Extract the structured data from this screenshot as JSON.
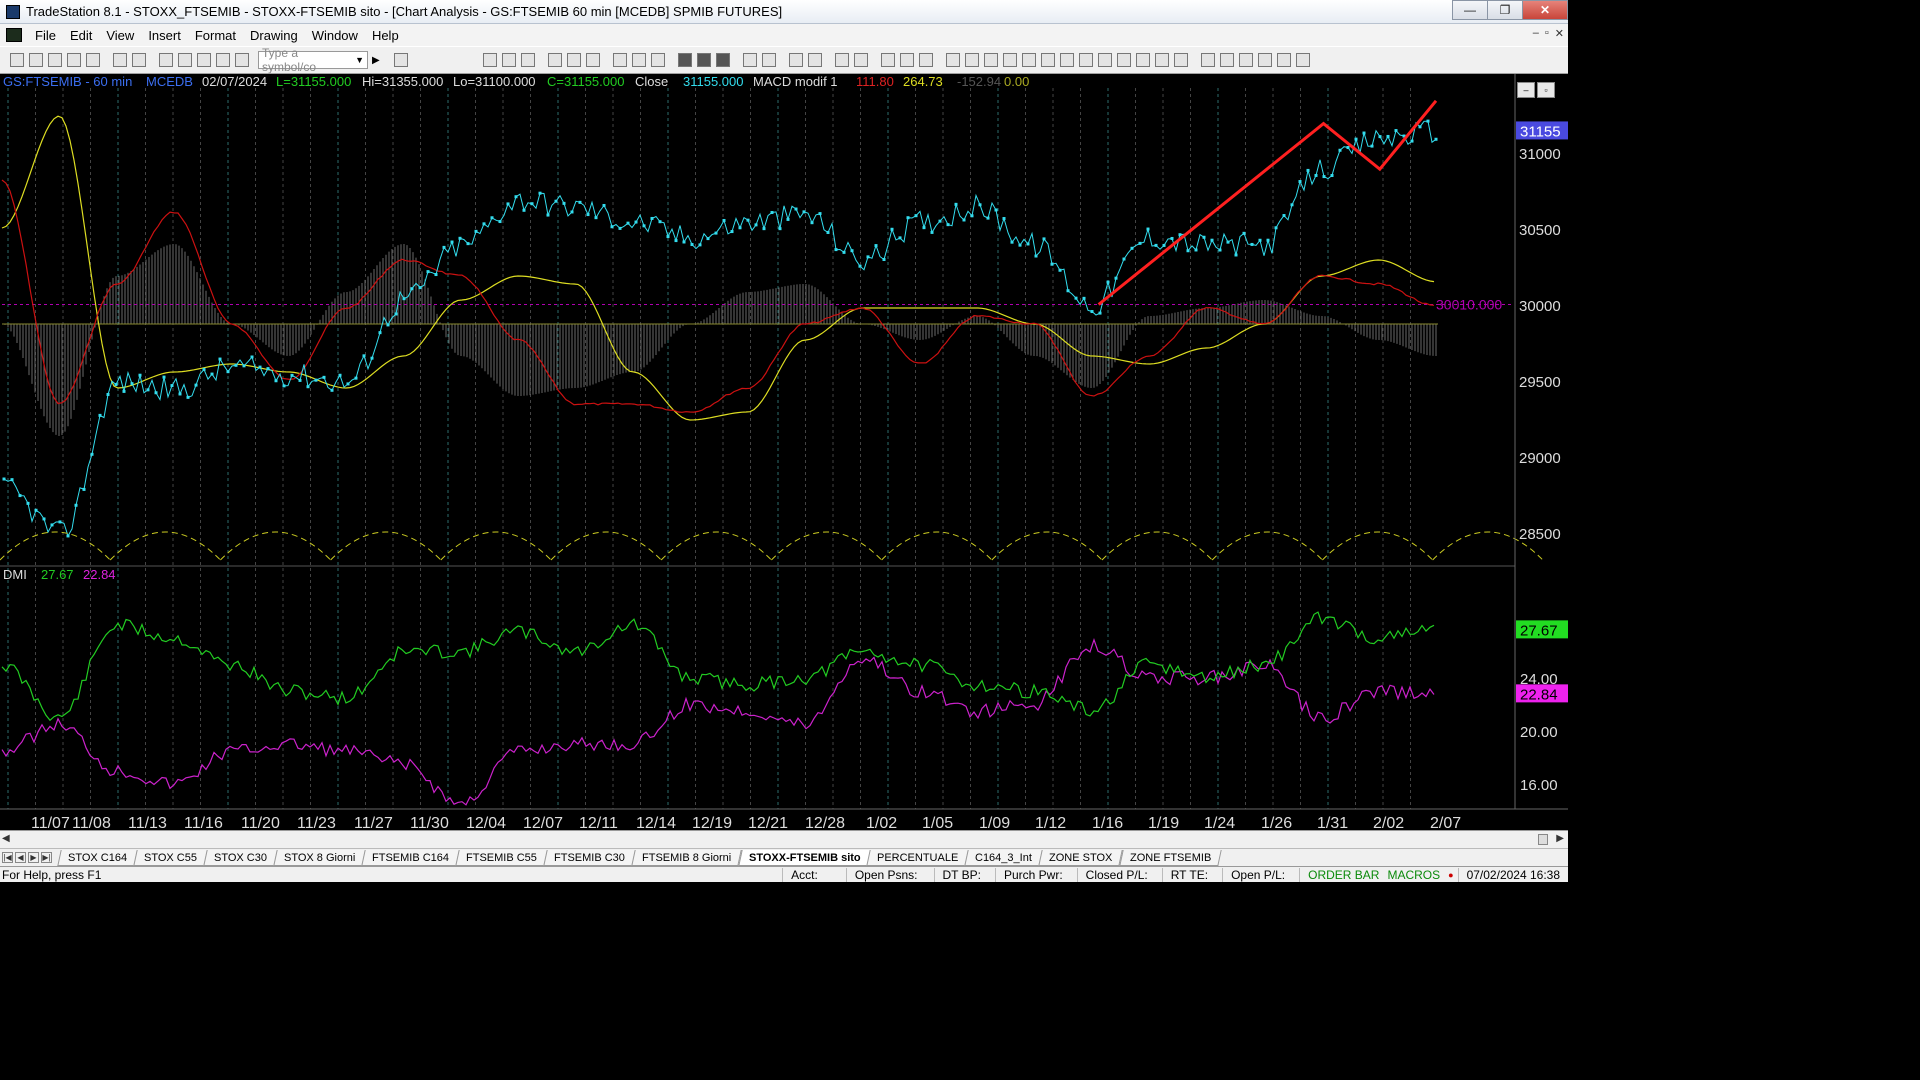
{
  "window": {
    "title": "TradeStation 8.1 - STOXX_FTSEMIB - STOXX-FTSEMIB sito - [Chart Analysis - GS:FTSEMIB  60 min  [MCEDB] SPMIB FUTURES]",
    "min_glyph": "—",
    "max_glyph": "❐",
    "close_glyph": "✕"
  },
  "menu": {
    "items": [
      "File",
      "Edit",
      "View",
      "Insert",
      "Format",
      "Drawing",
      "Window",
      "Help"
    ],
    "mdi": [
      "–",
      "▫",
      "✕"
    ]
  },
  "toolbar": {
    "symbol_placeholder": "Type a symbol/co",
    "dropdown_glyph": "▼",
    "go_glyph": "▶"
  },
  "chart_header": {
    "symbol": "GS:FTSEMIB - 60 min",
    "data_feed": "MCEDB",
    "date": "02/07/2024",
    "low_label": "L=31155.000",
    "high": "Hi=31355.000",
    "lo": "Lo=31100.000",
    "close": "C=31155.000",
    "close_label": "Close",
    "close_value": "31155.000",
    "macd_name": "MACD modif 1",
    "macd_v1": "111.80",
    "macd_v2": "264.73",
    "macd_v3": "-152.94",
    "macd_v4": "0.00"
  },
  "dmi_header": {
    "name": "DMI",
    "plus": "27.67",
    "minus": "22.84"
  },
  "price_axis": {
    "current": "31155",
    "level_label": "30010.000",
    "labels": [
      "31000",
      "30500",
      "30000",
      "29500",
      "29000",
      "28500"
    ]
  },
  "dmi_axis": {
    "current_plus": "27.67",
    "current_minus": "22.84",
    "labels": [
      "24.00",
      "20.00",
      "16.00"
    ]
  },
  "time_axis": {
    "labels": [
      "11/07",
      "11/08",
      "11/13",
      "11/16",
      "11/20",
      "11/23",
      "11/27",
      "11/30",
      "12/04",
      "12/07",
      "12/11",
      "12/14",
      "12/19",
      "12/21",
      "12/28",
      "1/02",
      "1/05",
      "1/09",
      "1/12",
      "1/16",
      "1/19",
      "1/24",
      "1/26",
      "1/31",
      "2/02",
      "2/07"
    ]
  },
  "tabs": [
    "STOX C164",
    "STOX C55",
    "STOX  C30",
    "STOX  8 Giorni",
    "FTSEMIB C164",
    "FTSEMIB C55",
    "FTSEMIB C30",
    "FTSEMIB  8 Giorni",
    "STOXX-FTSEMIB sito",
    "PERCENTUALE",
    "C164_3_Int",
    "ZONE STOX",
    "ZONE FTSEMIB"
  ],
  "active_tab": "STOXX-FTSEMIB sito",
  "scroll": {
    "left": "◀",
    "right": "▶"
  },
  "statusbar": {
    "help": "For Help, press F1",
    "fields": [
      "Acct:",
      "Open Psns:",
      "DT BP:",
      "Purch Pwr:",
      "Closed P/L:",
      "RT TE:",
      "Open P/L:"
    ],
    "order_bar": "ORDER BAR",
    "macros": "MACROS",
    "datetime": "07/02/2024 16:38"
  },
  "colors": {
    "price": "#33ddee",
    "macd_red": "#cc1111",
    "macd_yellow": "#dddd22",
    "histogram": "#6a6a6a",
    "trend": "#ff2020",
    "dmi_plus": "#22cc22",
    "dmi_minus": "#cc22cc",
    "cycle": "#cccc22",
    "level": "#b000b0"
  },
  "chart_data": [
    {
      "type": "line",
      "title": "GS:FTSEMIB - 60 min",
      "series_name": "Close",
      "ylim": [
        28300,
        31500
      ],
      "x": [
        "11/07",
        "11/08",
        "11/13",
        "11/16",
        "11/20",
        "11/23",
        "11/27",
        "11/30",
        "12/04",
        "12/07",
        "12/11",
        "12/14",
        "12/19",
        "12/21",
        "12/28",
        "1/02",
        "1/05",
        "1/09",
        "1/12",
        "1/16",
        "1/19",
        "1/24",
        "1/26",
        "1/31",
        "2/02",
        "2/07"
      ],
      "values": [
        28800,
        28500,
        29500,
        29450,
        29600,
        29550,
        29500,
        30050,
        30400,
        30700,
        30650,
        30550,
        30450,
        30550,
        30600,
        30300,
        30550,
        30650,
        30400,
        30000,
        30450,
        30400,
        30400,
        30900,
        31100,
        31155
      ],
      "level": 30010,
      "trend_line": [
        [
          30010,
          "1/16"
        ],
        [
          31200,
          "1/31"
        ],
        [
          30900,
          "2/02"
        ],
        [
          31350,
          "2/07"
        ]
      ]
    },
    {
      "type": "bar",
      "title": "MACD modif 1",
      "histogram": [
        0,
        -700,
        300,
        500,
        0,
        -200,
        200,
        500,
        -200,
        -450,
        -400,
        -300,
        0,
        200,
        250,
        0,
        -100,
        50,
        -200,
        -400,
        50,
        100,
        150,
        50,
        -100,
        -200
      ],
      "macd_line": [
        900,
        -500,
        250,
        700,
        0,
        -350,
        100,
        400,
        300,
        -100,
        -500,
        -500,
        -550,
        -400,
        0,
        100,
        -250,
        50,
        0,
        -450,
        -200,
        100,
        0,
        300,
        250,
        111.8
      ],
      "signal_line": [
        600,
        1300,
        -400,
        -300,
        -250,
        -300,
        -400,
        -200,
        150,
        300,
        250,
        -300,
        -600,
        -550,
        -100,
        100,
        100,
        100,
        0,
        -200,
        -250,
        -150,
        0,
        300,
        400,
        264.73
      ]
    },
    {
      "type": "line",
      "title": "DMI",
      "ylim": [
        14,
        30
      ],
      "x": [
        "11/07",
        "11/08",
        "11/13",
        "11/16",
        "11/20",
        "11/23",
        "11/27",
        "11/30",
        "12/04",
        "12/07",
        "12/11",
        "12/14",
        "12/19",
        "12/21",
        "12/28",
        "1/02",
        "1/05",
        "1/09",
        "1/12",
        "1/16",
        "1/19",
        "1/24",
        "1/26",
        "1/31",
        "2/02",
        "2/07"
      ],
      "series": [
        {
          "name": "DMI+",
          "values": [
            25,
            21,
            28,
            27,
            25,
            23,
            22.5,
            26,
            26,
            27.5,
            26,
            28,
            24,
            23.5,
            24,
            26,
            25,
            23.5,
            23,
            21.5,
            25,
            24,
            25,
            28.5,
            27,
            27.67
          ]
        },
        {
          "name": "DMI-",
          "values": [
            18.5,
            20.5,
            17,
            16,
            18.5,
            19,
            18.5,
            17.5,
            14.5,
            18.5,
            19,
            19,
            22,
            21.5,
            20.5,
            25.5,
            23,
            21.5,
            22,
            26.5,
            24,
            24,
            25,
            21,
            23,
            22.84
          ]
        }
      ]
    }
  ]
}
